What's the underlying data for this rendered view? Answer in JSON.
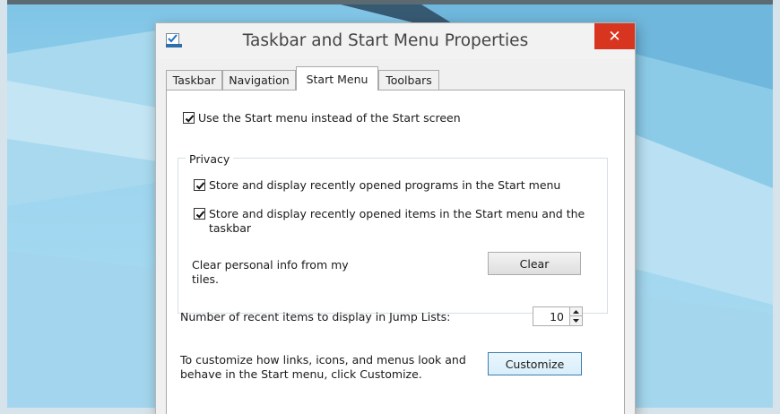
{
  "window": {
    "title": "Taskbar and Start Menu Properties",
    "close_glyph": "✕"
  },
  "tabs": [
    {
      "label": "Taskbar",
      "active": false
    },
    {
      "label": "Navigation",
      "active": false
    },
    {
      "label": "Start Menu",
      "active": true
    },
    {
      "label": "Toolbars",
      "active": false
    }
  ],
  "start_menu": {
    "use_start_menu_label": "Use the Start menu instead of the Start screen",
    "use_start_menu_checked": true,
    "privacy": {
      "title": "Privacy",
      "store_programs_label": "Store and display recently opened programs in the Start menu",
      "store_programs_checked": true,
      "store_items_label_line1": "Store and display recently opened items in the Start menu and the",
      "store_items_label_line2": "taskbar",
      "store_items_checked": true,
      "clear_info_line1": "Clear personal info from my",
      "clear_info_line2": "tiles.",
      "clear_button": "Clear"
    },
    "jump_lists_label": "Number of recent items to display in Jump Lists:",
    "jump_lists_value": "10",
    "customize_line1": "To customize how links, icons, and menus look and",
    "customize_line2": "behave in the Start menu, click Customize.",
    "customize_button": "Customize"
  },
  "colors": {
    "close_button": "#d7351f",
    "wallpaper": "#9fd6ef",
    "focus_border": "#3c7fb1"
  },
  "icons": {
    "app": "taskbar-properties-icon",
    "check": "checkmark-icon",
    "spin_up": "spin-up-arrow-icon",
    "spin_down": "spin-down-arrow-icon"
  }
}
